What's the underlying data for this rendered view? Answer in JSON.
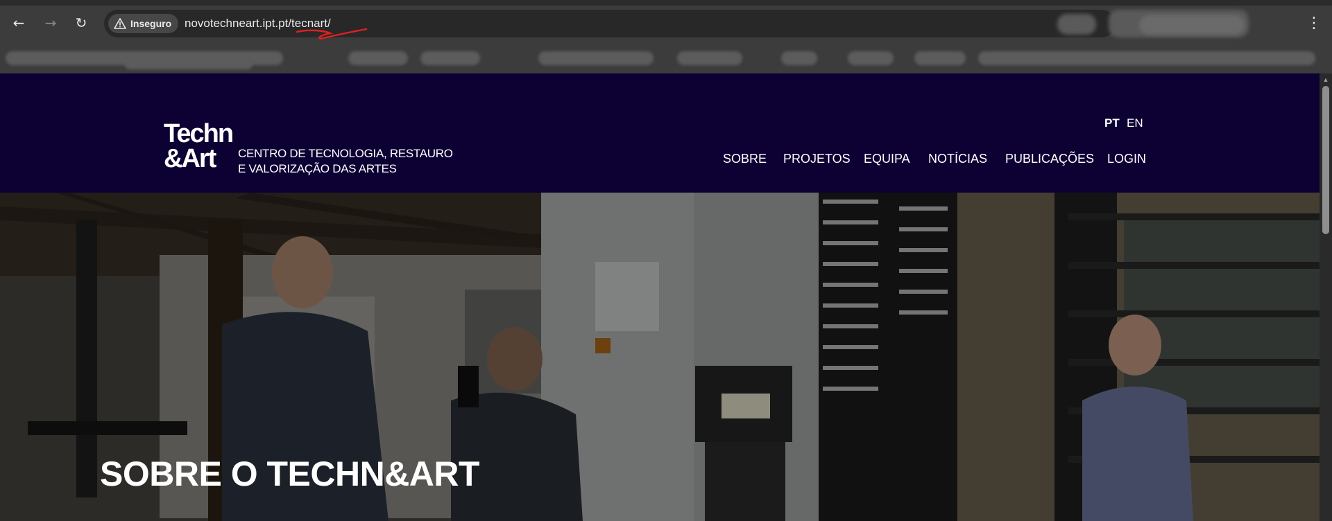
{
  "browser": {
    "security_label": "Inseguro",
    "url_host": "novotechneart.ipt.pt/",
    "url_path": "tecnart/",
    "back_icon": "arrow-left-icon",
    "forward_icon": "arrow-right-icon",
    "reload_icon": "reload-icon",
    "menu_icon": "kebab-menu-icon",
    "annotation_color": "#e02020"
  },
  "site": {
    "logo_line1": "Techn",
    "logo_line2": "&Art",
    "logo_tagline1": "CENTRO DE TECNOLOGIA, RESTAURO",
    "logo_tagline2": "E VALORIZAÇÃO DAS ARTES",
    "languages": [
      "PT",
      "EN"
    ],
    "active_language": "PT",
    "menu": [
      "SOBRE",
      "PROJETOS",
      "EQUIPA",
      "NOTÍCIAS",
      "PUBLICAÇÕES",
      "LOGIN"
    ],
    "header_color": "#0d0033",
    "hero_title": "SOBRE O TECHN&ART"
  }
}
